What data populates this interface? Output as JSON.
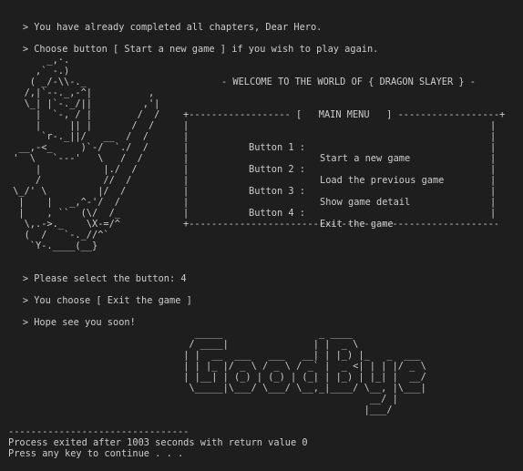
{
  "console": {
    "intro_line_1": "You have already completed all chapters, Dear Hero.",
    "intro_line_2": "Choose button [ Start a new game ] if you wish to play again.",
    "prompt_glyph": ">",
    "select_line": "Please select the button: 4",
    "choose_line": "You choose [ Exit the game ]",
    "goodbye_line": "Hope see you soon!",
    "separator": "--------------------------------",
    "exit_line": "Process exited after 1003 seconds with return value 0",
    "continue_line": "Press any key to continue . . ."
  },
  "hero_art": "       _,·.\n     ,` -.)\n    ( _/-\\\\-._\n   /,|`--._,-^|          ,\n   \\_| |`-._/||         ,'|\n     |  `-, / |        /  /\n     |     || |       /  /\n      `r-._||/   __  /  /\n  __,-<_     )`-/  `./  /\n '  \\   `---'   \\   /  /\n     |           |./  /\n     /           //  /\n \\_/' \\         |/  /\n  |    |   _,^-'/  /\n  |    , ``  (\\/  /_\n   \\,.->._    \\X-=/^\n   (  /   `-._//^`\n    `Y-.____(__}",
  "menu": {
    "welcome_title": "- WELCOME TO THE WORLD OF { DRAGON SLAYER } -",
    "top_border": "+------------------ [   MAIN MENU   ] ------------------+",
    "bottom_border": "+--------------------------------------------------------------------------------+",
    "items": [
      {
        "label": "Button 1 :",
        "action": "Start a new game"
      },
      {
        "label": "Button 2 :",
        "action": "Load the previous game"
      },
      {
        "label": "Button 3 :",
        "action": "Show game detail"
      },
      {
        "label": "Button 4 :",
        "action": "Exit the game"
      }
    ]
  },
  "goodbye_art": "   _____                 _ ____\n  / ____|               | |  _ \\\n | |  __  ___   ___   __| | |_) |_   _  ___\n | | |_ |/ _ \\ / _ \\ / _` |  _ <| | | |/ _ \\\n | |__| | (_) | (_) | (_| | |_) | |_| |  __/\n  \\_____|\\___/ \\___/ \\__,_|____/ \\__, |\\___|\n                                  __/ |\n                                 |___/"
}
